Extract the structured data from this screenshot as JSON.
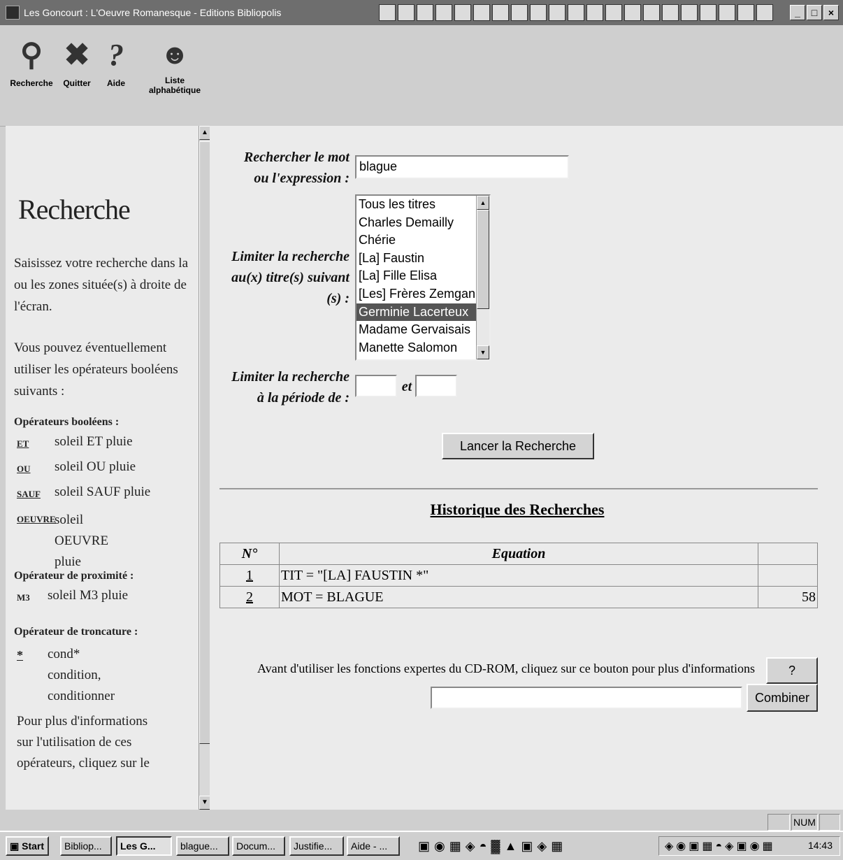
{
  "window": {
    "title": "Les Goncourt : L'Oeuvre Romanesque - Editions Bibliopolis",
    "controls": [
      "_",
      "□",
      "×"
    ]
  },
  "toolbar": {
    "recherche": "Recherche",
    "quitter": "Quitter",
    "aide": "Aide",
    "liste_line1": "Liste",
    "liste_line2": "alphabétique"
  },
  "sidebar": {
    "heading": "Recherche",
    "intro": "Saisissez votre recherche dans la ou les zones située(s) à droite de l'écran.",
    "bool_intro": "Vous pouvez éventuellement utiliser les opérateurs booléens suivants :",
    "bool_heading": "Opérateurs booléens :",
    "ops": [
      {
        "key": "ET",
        "example": "soleil ET pluie"
      },
      {
        "key": "OU",
        "example": "soleil OU pluie"
      },
      {
        "key": "SAUF",
        "example": "soleil SAUF pluie"
      },
      {
        "key": "OEUVRE",
        "example": "soleil OEUVRE pluie"
      }
    ],
    "prox_heading": "Opérateur de proximité :",
    "prox_key": "M3",
    "prox_example": "soleil M3 pluie",
    "trunc_heading": "Opérateur de troncature :",
    "trunc_key": "*",
    "trunc_example": "cond*",
    "trunc_line2": "condition,",
    "trunc_line3": "conditionner",
    "more": "Pour plus d'informations sur l'utilisation de ces opérateurs, cliquez sur le"
  },
  "form": {
    "search_label_1": "Rechercher le mot",
    "search_label_2": "ou l'expression :",
    "search_value": "blague",
    "titles_label_1": "Limiter la recherche",
    "titles_label_2": "au(x) titre(s) suivant",
    "titles_label_3": "(s) :",
    "titles": [
      "Tous les titres",
      "Charles Demailly",
      "Chérie",
      "[La] Faustin",
      "[La] Fille Elisa",
      "[Les] Frères Zemganno",
      "Germinie Lacerteux",
      "Madame Gervaisais",
      "Manette Salomon"
    ],
    "selected_title": "Germinie Lacerteux",
    "period_label_1": "Limiter la recherche",
    "period_label_2": "à la période de :",
    "period_and": "et",
    "period_from": "",
    "period_to": "",
    "submit": "Lancer la Recherche"
  },
  "history": {
    "title": "Historique des Recherches",
    "col_num": "N°",
    "col_eq": "Equation",
    "col_count": "",
    "rows": [
      {
        "num": "1",
        "eq": "TIT = \"[LA] FAUSTIN *\"",
        "count": ""
      },
      {
        "num": "2",
        "eq": "MOT = BLAGUE",
        "count": "58"
      }
    ]
  },
  "expert": {
    "text": "Avant d'utiliser les fonctions expertes du CD-ROM, cliquez sur ce bouton pour plus d'informations",
    "help_btn": "?",
    "combine_value": "",
    "combine_btn": "Combiner"
  },
  "status": {
    "num": "NUM"
  },
  "taskbar": {
    "start": "Start",
    "tasks": [
      "Bibliop...",
      "Les G...",
      "blague...",
      "Docum...",
      "Justifie...",
      "Aide - ..."
    ],
    "time": "14:43"
  }
}
